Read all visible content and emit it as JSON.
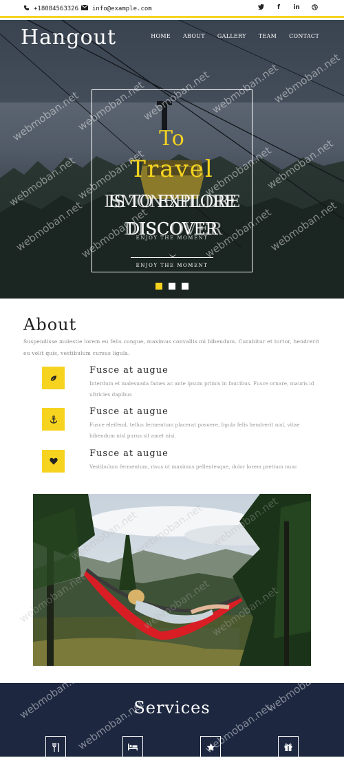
{
  "topbar": {
    "phone": "+18084563326",
    "email": "info@example.com",
    "social": [
      "twitter-icon",
      "facebook-icon",
      "linkedin-icon",
      "dribbble-icon"
    ]
  },
  "hero": {
    "brand": "Hangout",
    "nav": [
      "HOME",
      "ABOUT",
      "GALLERY",
      "TEAM",
      "CONTACT"
    ],
    "slide_title_top": "To",
    "slide_title_main": "Travel",
    "overlap_line_a": "IS TO EXPLORE",
    "overlap_line_b": "ISMONEHILDRE",
    "discover_a": "DISCOVER",
    "discover_b": "DISCOVER",
    "tagline_a": "ENJOY THE MOMENT",
    "tagline_b": "ENJOY THE MOMENT",
    "slide_count": 3,
    "active_slide": 0
  },
  "about": {
    "title": "About",
    "text": "Suspendisse molestie lorem eu felis congue, maximus convallis mi bibendum. Curabitur et tortor, hendrerit eu velit quis, vestibulum cursus ligula.",
    "features": [
      {
        "icon": "leaf-icon",
        "title": "Fusce at augue",
        "desc": "Interdum et malesuada fames ac ante ipsum primis in faucibus. Fusce ornare, mauris id ultricies dapibus"
      },
      {
        "icon": "anchor-icon",
        "title": "Fusce at augue",
        "desc": "Fusce eleifend, tellus fermentum placerat posuere, ligula felis hendrerit nisl, vitae bibendum nisl purus sit amet nisi."
      },
      {
        "icon": "heart-icon",
        "title": "Fusce at augue",
        "desc": "Vestibulum fermentum, risus ut maximus pellentesque, dolor lorem pretium nunc"
      }
    ]
  },
  "services": {
    "title": "Services",
    "icons": [
      "cutlery-icon",
      "bed-icon",
      "star-icon",
      "gift-icon"
    ]
  },
  "watermark": "webmoban.net",
  "colors": {
    "accent": "#f5d31f",
    "navy": "#1d2740",
    "muted": "#999999"
  }
}
